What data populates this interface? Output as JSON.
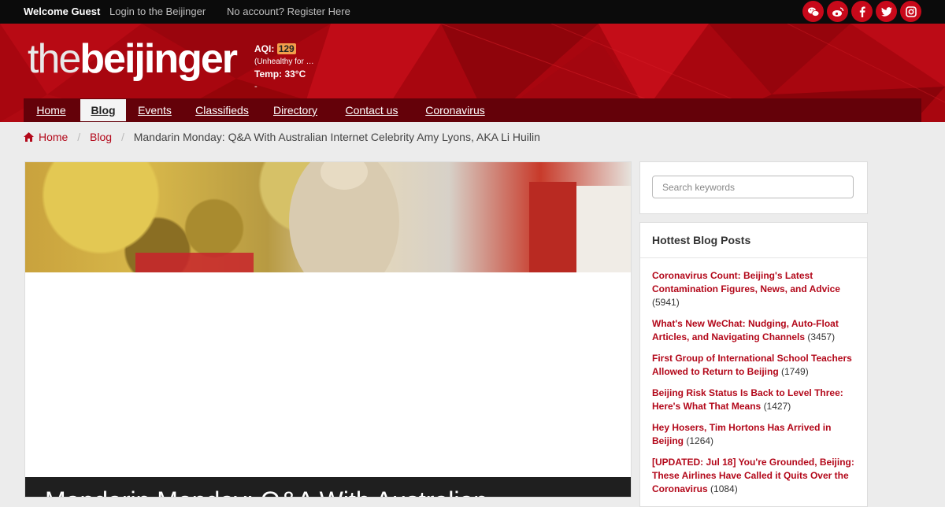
{
  "topbar": {
    "welcome": "Welcome Guest",
    "login": "Login to the Beijinger",
    "register": "No account? Register Here",
    "social": [
      "wechat-icon",
      "weibo-icon",
      "facebook-icon",
      "twitter-icon",
      "instagram-icon"
    ]
  },
  "header": {
    "logo_the": "the",
    "logo_beijinger": "beijinger",
    "aqi_label": "AQI:",
    "aqi_value": "129",
    "aqi_status": "(Unhealthy for …",
    "temp": "Temp: 33°C",
    "dash": "-"
  },
  "nav": {
    "items": [
      "Home",
      "Blog",
      "Events",
      "Classifieds",
      "Directory",
      "Contact us",
      "Coronavirus"
    ],
    "active": "Blog"
  },
  "breadcrumb": {
    "home": "Home",
    "blog": "Blog",
    "current": "Mandarin Monday: Q&A With Australian Internet Celebrity Amy Lyons, AKA Li Huilin"
  },
  "article": {
    "title_visible": "Mandarin Monday: Q&A With Australian"
  },
  "sidebar": {
    "search_placeholder": "Search keywords",
    "hottest_title": "Hottest Blog Posts",
    "posts": [
      {
        "title": "Coronavirus Count: Beijing's Latest Contamination Figures, News, and Advice",
        "count": "(5941)"
      },
      {
        "title": "What's New WeChat: Nudging, Auto-Float Articles, and Navigating Channels",
        "count": "(3457)"
      },
      {
        "title": "First Group of International School Teachers Allowed to Return to Beijing",
        "count": "(1749)"
      },
      {
        "title": "Beijing Risk Status Is Back to Level Three: Here's What That Means",
        "count": "(1427)"
      },
      {
        "title": "Hey Hosers, Tim Hortons Has Arrived in Beijing",
        "count": "(1264)"
      },
      {
        "title": "[UPDATED: Jul 18] You're Grounded, Beijing: These Airlines Have Called it Quits Over the Coronavirus",
        "count": "(1084)"
      }
    ]
  },
  "colors": {
    "brand_red": "#c8091a",
    "nav_dark": "#640109",
    "link_red": "#b3081a",
    "aqi_badge": "#f29e4c"
  }
}
